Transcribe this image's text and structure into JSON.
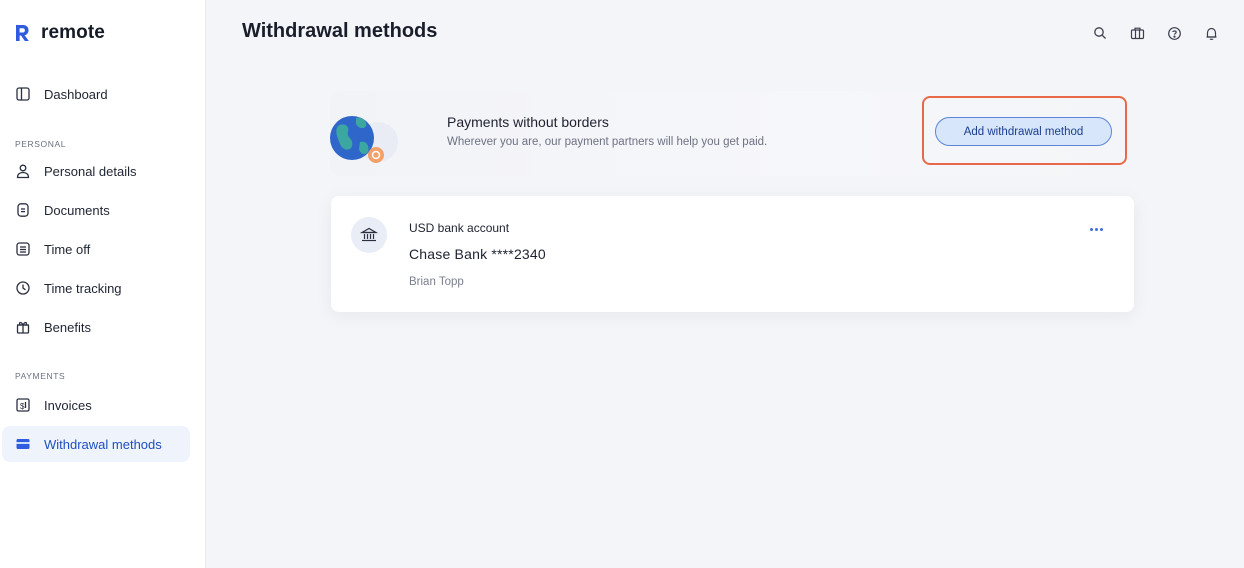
{
  "brand": {
    "name": "remote",
    "accent": "#1f4fbf"
  },
  "sidebar": {
    "items_top": [
      {
        "label": "Dashboard",
        "icon": "dashboard-icon"
      }
    ],
    "sections": [
      {
        "label": "PERSONAL",
        "items": [
          {
            "label": "Personal details",
            "icon": "person-icon"
          },
          {
            "label": "Documents",
            "icon": "document-icon"
          },
          {
            "label": "Time off",
            "icon": "calendar-icon"
          },
          {
            "label": "Time tracking",
            "icon": "clock-icon"
          },
          {
            "label": "Benefits",
            "icon": "gift-icon"
          }
        ]
      },
      {
        "label": "PAYMENTS",
        "items": [
          {
            "label": "Invoices",
            "icon": "invoice-icon"
          },
          {
            "label": "Withdrawal methods",
            "icon": "card-icon",
            "active": true
          }
        ]
      }
    ]
  },
  "header": {
    "title": "Withdrawal methods",
    "icons": [
      "search-icon",
      "briefcase-icon",
      "help-icon",
      "bell-icon"
    ]
  },
  "promo": {
    "title": "Payments without borders",
    "subtitle": "Wherever you are, our payment partners will help you get paid.",
    "button_label": "Add withdrawal method"
  },
  "account": {
    "type": "USD bank account",
    "name": "Chase Bank ****2340",
    "holder": "Brian Topp",
    "icon": "bank-icon"
  },
  "colors": {
    "highlight": "#e8694a",
    "button_bg": "#d8e6fb",
    "button_border": "#5b86d6",
    "main_bg": "#f4f5f8"
  }
}
